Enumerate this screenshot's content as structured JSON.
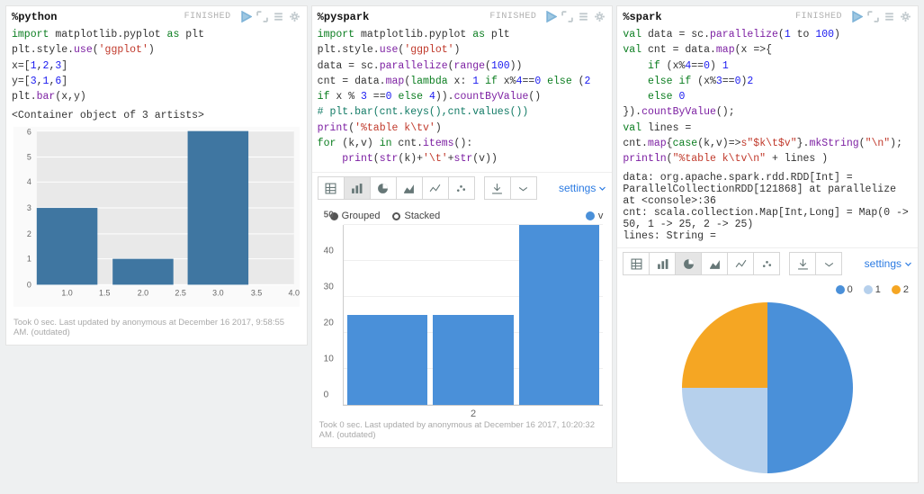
{
  "panel1": {
    "magic": "%python",
    "status": "FINISHED",
    "code_html": "<span class='tok-kw'>import</span> matplotlib.pyplot <span class='tok-kw'>as</span> plt\nplt.style.<span class='tok-fn'>use</span>(<span class='tok-str'>'ggplot'</span>)\nx=[<span class='tok-num'>1</span>,<span class='tok-num'>2</span>,<span class='tok-num'>3</span>]\ny=[<span class='tok-num'>3</span>,<span class='tok-num'>1</span>,<span class='tok-num'>6</span>]\nplt.<span class='tok-fn'>bar</span>(x,y)",
    "output": "<Container object of 3 artists>",
    "footnote": "Took 0 sec. Last updated by anonymous at December 16 2017, 9:58:55 AM. (outdated)"
  },
  "panel2": {
    "magic": "%pyspark",
    "status": "FINISHED",
    "code_html": "<span class='tok-kw'>import</span> matplotlib.pyplot <span class='tok-kw'>as</span> plt\nplt.style.<span class='tok-fn'>use</span>(<span class='tok-str'>'ggplot'</span>)\ndata = sc.<span class='tok-fn'>parallelize</span>(<span class='tok-fn'>range</span>(<span class='tok-num'>100</span>))\ncnt = data.<span class='tok-fn'>map</span>(<span class='tok-kw'>lambda</span> x: <span class='tok-num'>1</span> <span class='tok-kw'>if</span> x%<span class='tok-num'>4</span>==<span class='tok-num'>0</span> <span class='tok-kw'>else</span> (<span class='tok-num'>2</span> <span class='tok-kw'>if</span> x % <span class='tok-num'>3</span> ==<span class='tok-num'>0</span> <span class='tok-kw'>else</span> <span class='tok-num'>4</span>)).<span class='tok-fn'>countByValue</span>()\n<span class='tok-cm'># plt.bar(cnt.keys(),cnt.values())</span>\n<span class='tok-fn'>print</span>(<span class='tok-str'>'%table k\\tv'</span>)\n<span class='tok-kw'>for</span> (k,v) <span class='tok-kw'>in</span> cnt.<span class='tok-fn'>items</span>():\n    <span class='tok-fn'>print</span>(<span class='tok-fn'>str</span>(k)+<span class='tok-str'>'\\t'</span>+<span class='tok-fn'>str</span>(v))",
    "legend_grouped": "Grouped",
    "legend_stacked": "Stacked",
    "series_name": "v",
    "xcat": "2",
    "settings_label": "settings",
    "footnote": "Took 0 sec. Last updated by anonymous at December 16 2017, 10:20:32 AM. (outdated)"
  },
  "panel3": {
    "magic": "%spark",
    "status": "FINISHED",
    "code_html": "<span class='tok-scala-kw'>val</span> data = sc.<span class='tok-fn'>parallelize</span>(<span class='tok-num'>1</span> to <span class='tok-num'>100</span>)\n<span class='tok-scala-kw'>val</span> cnt = data.<span class='tok-fn'>map</span>(x =&gt;{\n    <span class='tok-kw'>if</span> (x%<span class='tok-num'>4</span>==<span class='tok-num'>0</span>) <span class='tok-num'>1</span>\n    <span class='tok-kw'>else if</span> (x%<span class='tok-num'>3</span>==<span class='tok-num'>0</span>)<span class='tok-num'>2</span>\n    <span class='tok-kw'>else</span> <span class='tok-num'>0</span>\n}).<span class='tok-fn'>countByValue</span>();\n<span class='tok-scala-kw'>val</span> lines = cnt.<span class='tok-fn'>map</span>{<span class='tok-kw'>case</span>(k,v)=&gt;<span class='tok-str'>s\"$k\\t$v\"</span>}.<span class='tok-fn'>mkString</span>(<span class='tok-str'>\"\\n\"</span>);\n<span class='tok-fn'>println</span>(<span class='tok-str'>\"%table k\\tv\\n\"</span> + lines )",
    "output": "data: org.apache.spark.rdd.RDD[Int] = ParallelCollectionRDD[121868] at parallelize at <console>:36\ncnt: scala.collection.Map[Int,Long] = Map(0 -> 50, 1 -> 25, 2 -> 25)\nlines: String =",
    "legend0": "0",
    "legend1": "1",
    "legend2": "2",
    "settings_label": "settings"
  },
  "chart_data": [
    {
      "type": "bar",
      "panel": 1,
      "title": "",
      "x": [
        1,
        2,
        3
      ],
      "y": [
        3,
        1,
        6
      ],
      "xlim": [
        0.5,
        4.0
      ],
      "ylim": [
        0,
        6
      ],
      "xticks": [
        1.0,
        1.5,
        2.0,
        2.5,
        3.0,
        3.5,
        4.0
      ],
      "yticks": [
        0,
        1,
        2,
        3,
        4,
        5,
        6
      ],
      "style": "ggplot"
    },
    {
      "type": "bar",
      "panel": 2,
      "mode": "grouped",
      "categories": [
        "2"
      ],
      "series": [
        {
          "name": "v",
          "values": [
            25,
            25,
            50
          ]
        }
      ],
      "ylim": [
        0,
        50
      ],
      "yticks": [
        0,
        10,
        20,
        30,
        40,
        50
      ],
      "colors": [
        "#4a90d9"
      ]
    },
    {
      "type": "pie",
      "panel": 3,
      "categories": [
        "0",
        "1",
        "2"
      ],
      "values": [
        50,
        25,
        25
      ],
      "colors": [
        "#4a90d9",
        "#b6d0ec",
        "#f5a623"
      ]
    }
  ]
}
